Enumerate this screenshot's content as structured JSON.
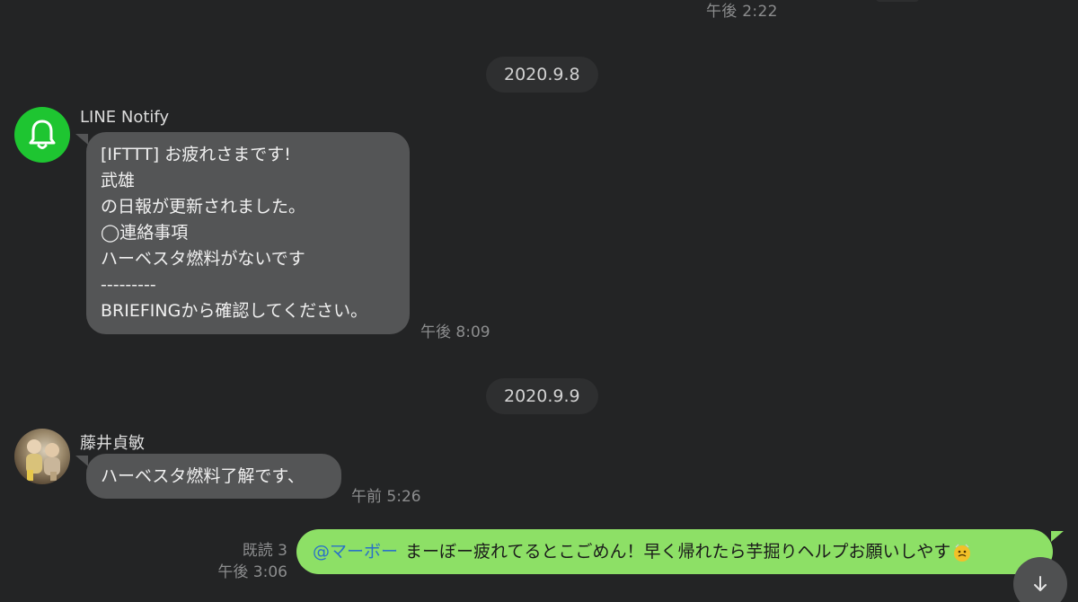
{
  "top": {
    "time": "午後 2:22"
  },
  "dates": [
    "2020.9.8",
    "2020.9.9"
  ],
  "messages": [
    {
      "sender": "LINE Notify",
      "avatar": "bell-icon",
      "lines": [
        "[IFTTT] お疲れさまです!",
        "武雄",
        "の日報が更新されました。",
        "◯連絡事項",
        "ハーベスタ燃料がないです",
        "---------",
        "BRIEFINGから確認してください。"
      ],
      "time": "午後 8:09"
    },
    {
      "sender": "藤井貞敏",
      "avatar": "user-photo",
      "text": "ハーベスタ燃料了解です、",
      "time": "午前 5:26"
    },
    {
      "mine": true,
      "mention": "@マーボー",
      "text": "まーぼー疲れてるとこごめん！早く帰れたら芋掘りヘルプお願いしやす",
      "read": "既読 3",
      "time": "午後 3:06"
    }
  ],
  "colors": {
    "background": "#232425",
    "bubble_other": "#545556",
    "bubble_mine": "#8de066",
    "mention": "#2a72c8",
    "notify_green": "#1ec531"
  },
  "controls": {
    "scroll_down_icon": "arrow-down-icon"
  }
}
